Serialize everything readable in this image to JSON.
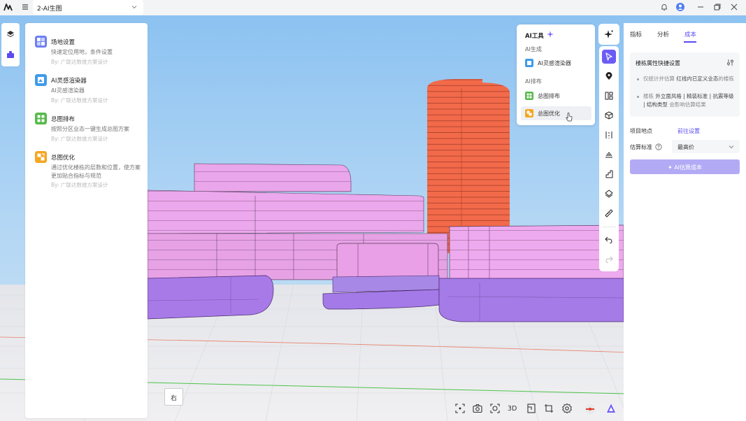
{
  "window": {
    "project_name": "2-AI生图"
  },
  "left_panel": {
    "items": [
      {
        "title": "场地设置",
        "desc": "快速定位用地，条件设置",
        "by": "By: 广联达数维方案设计",
        "icon": "site-setup-icon"
      },
      {
        "title": "AI灵感渲染器",
        "desc": "AI灵感渲染器",
        "by": "By: 广联达数维方案设计",
        "icon": "ai-render-icon"
      },
      {
        "title": "总图排布",
        "desc": "按照分区业态一键生成总图方案",
        "by": "By: 广联达数维方案设计",
        "icon": "master-plan-layout-icon"
      },
      {
        "title": "总图优化",
        "desc": "通过优化楼栋的层数和位置，使方案更加贴合指标与规范",
        "by": "By: 广联达数维方案设计",
        "icon": "master-plan-optimize-icon"
      }
    ]
  },
  "ai_popup": {
    "title": "AI工具",
    "section_generate": "AI生成",
    "item_render": "AI灵感渲染器",
    "section_layout": "AI排布",
    "item_layout": "总图排布",
    "item_optimize": "总图优化"
  },
  "right_panel": {
    "tabs": [
      "指标",
      "分析",
      "成本"
    ],
    "active_tab": "成本",
    "card_title": "楼栋属性快捷设置",
    "bullet1_a": "仅统计并估算",
    "bullet1_b": "红线内已定义业态",
    "bullet1_c": "的楼栋",
    "bullet2_a": "楼栋",
    "bullet2_b": "外立面风格 | 精装标准 | 抗震等级 | 结构类型",
    "bullet2_c": "会影响估算结果",
    "location_label": "项目地点",
    "location_link": "前往设置",
    "standard_label": "估算标准",
    "standard_value": "最高价",
    "estimate_button": "✦ AI估算成本"
  },
  "bottom": {
    "view_label": "右",
    "mode_3d": "3D"
  },
  "colors": {
    "accent": "#6b5cf6",
    "sky_top": "#8ec4f2",
    "ground": "#eaeaec",
    "tower": "#f26d4f",
    "podium": "#e7a0e8",
    "base": "#a47ae8"
  }
}
